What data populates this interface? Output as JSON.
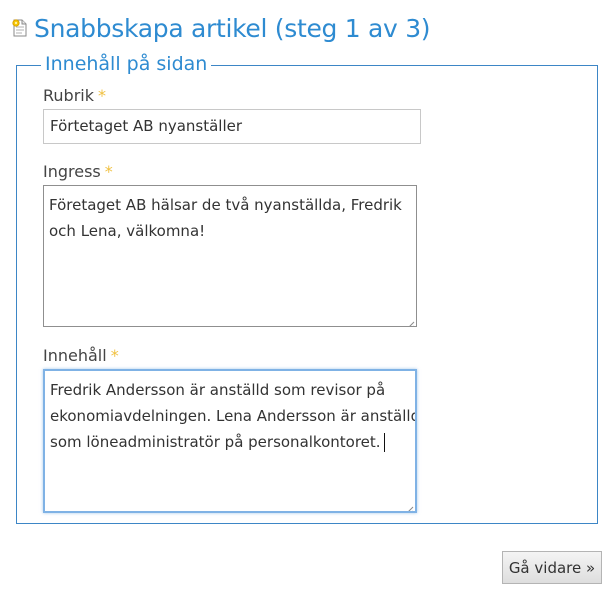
{
  "page": {
    "title": "Snabbskapa artikel (steg 1 av 3)",
    "icon": "new-article-icon"
  },
  "section": {
    "legend": "Innehåll på sidan"
  },
  "fields": {
    "rubrik": {
      "label": "Rubrik",
      "required_marker": "*",
      "value": "Förtetaget AB nyanställer"
    },
    "ingress": {
      "label": "Ingress",
      "required_marker": "*",
      "lines": [
        "Företaget AB hälsar de två nyanställda, Fredrik",
        "och Lena, välkomna!"
      ]
    },
    "innehall": {
      "label": "Innehåll",
      "required_marker": "*",
      "lines": [
        "Fredrik Andersson är anställd som revisor på",
        "ekonomiavdelningen. Lena Andersson är anställd",
        "som löneadministratör på personalkontoret."
      ]
    }
  },
  "actions": {
    "next_label": "Gå vidare »"
  },
  "colors": {
    "title": "#2e8bd1",
    "fieldset_border": "#3d86c6",
    "required": "#f0c040",
    "focus_border": "#7fb2e5"
  }
}
